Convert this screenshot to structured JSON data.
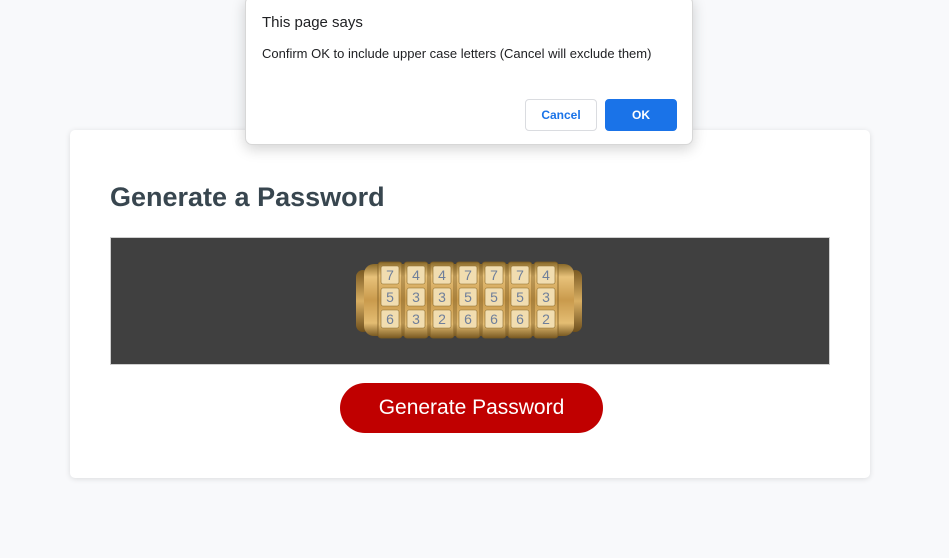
{
  "card": {
    "title": "Generate a Password",
    "button_label": "Generate Password"
  },
  "lock_image": {
    "icon": "cryptex-lock-icon",
    "top_row_digits": [
      "7",
      "4",
      "4",
      "7",
      "7",
      "7",
      "4"
    ],
    "middle_row_digits": [
      "5",
      "3",
      "3",
      "5",
      "5",
      "5",
      "3"
    ],
    "bottom_row_digits": [
      "6",
      "3",
      "2",
      "6",
      "6",
      "6",
      "2"
    ]
  },
  "dialog": {
    "title": "This page says",
    "message": "Confirm OK to include upper case letters (Cancel will exclude them)",
    "cancel_label": "Cancel",
    "ok_label": "OK"
  },
  "colors": {
    "page_background": "#f8f9fb",
    "title": "#38464f",
    "display_background": "#404040",
    "generate_button": "#c00000",
    "dialog_accent": "#1a73e8"
  }
}
